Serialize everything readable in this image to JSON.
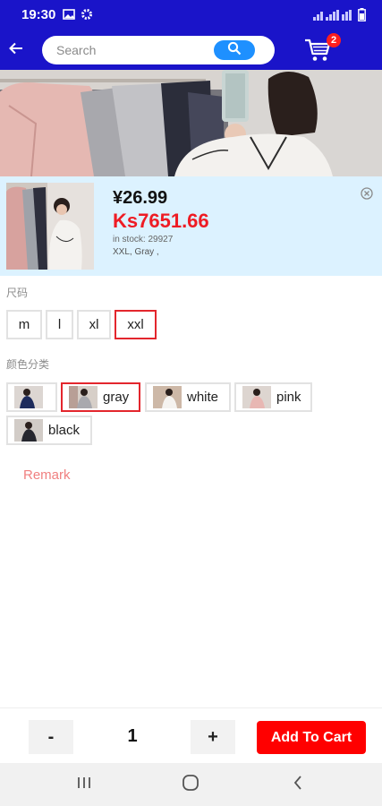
{
  "status_bar": {
    "time": "19:30"
  },
  "header": {
    "search_placeholder": "Search",
    "cart_count": "2"
  },
  "product": {
    "price_cny": "¥26.99",
    "price_ks": "Ks7651.66",
    "stock": "in stock: 29927",
    "selected": "XXL, Gray ,"
  },
  "size_section": {
    "label": "尺码",
    "options": [
      "m",
      "l",
      "xl",
      "xxl"
    ],
    "selected": "xxl"
  },
  "color_section": {
    "label": "颜色分类",
    "options": [
      "",
      "gray",
      "white",
      "pink",
      "black"
    ],
    "selected": "gray"
  },
  "remark_label": "Remark",
  "cart_bar": {
    "minus_label": "-",
    "quantity": "1",
    "plus_label": "+",
    "add_to_cart_label": "Add To Cart"
  },
  "colors": {
    "brand_blue": "#1a14c9",
    "search_button": "#1e90ff",
    "price_red": "#ee1c24",
    "selected_border": "#e3262d",
    "add_to_cart": "#ff0000",
    "info_panel_bg": "#dcf2ff",
    "remark": "#f08080"
  }
}
